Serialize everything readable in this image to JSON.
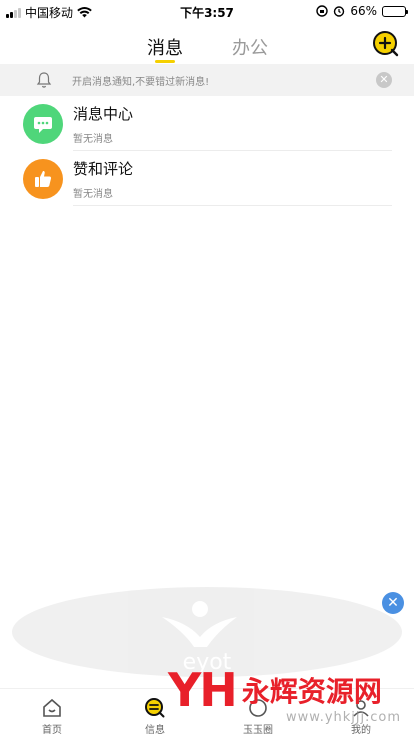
{
  "status_bar": {
    "carrier": "中国移动",
    "time": "下午3:57",
    "battery": "66%",
    "battery_level": 0.66
  },
  "header": {
    "tabs": [
      {
        "label": "消息",
        "active": true
      },
      {
        "label": "办公",
        "active": false
      }
    ],
    "add_icon": "plus-chat-icon",
    "accent_color": "#f5d000"
  },
  "notice": {
    "text": "开启消息通知,不要错过新消息!"
  },
  "messages": [
    {
      "title": "消息中心",
      "subtitle": "暂无消息",
      "icon": "chat-icon",
      "color": "#4fd67a"
    },
    {
      "title": "赞和评论",
      "subtitle": "暂无消息",
      "icon": "thumb-up-icon",
      "color": "#f7931e"
    }
  ],
  "watermark": {
    "text": "eyot"
  },
  "tabbar": {
    "items": [
      {
        "label": "首页",
        "icon": "home-icon"
      },
      {
        "label": "信息",
        "icon": "message-icon"
      },
      {
        "label": "玉玉圈",
        "icon": "circle-icon"
      },
      {
        "label": "我的",
        "icon": "profile-icon"
      }
    ]
  },
  "brand": {
    "logo": "YH",
    "name": "永辉资源网",
    "url": "www.yhkjjj.com"
  }
}
